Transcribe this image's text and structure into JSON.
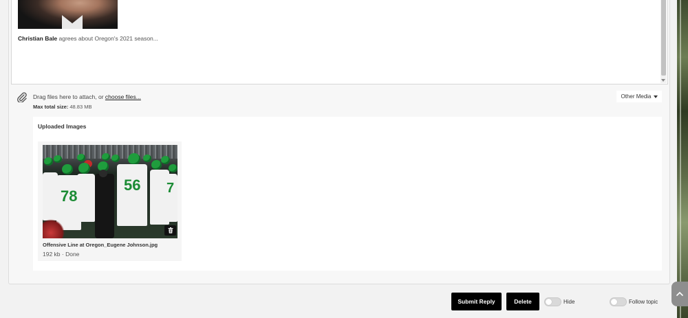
{
  "editor": {
    "quote_author": "Christian Bale",
    "quote_text": " agrees about Oregon's 2021 season..."
  },
  "attach": {
    "drag_text": "Drag files here to attach, or ",
    "choose_link": "choose files...",
    "max_label": "Max total size:",
    "max_value": " 48.83 MB",
    "other_media": "Other Media"
  },
  "uploaded": {
    "title": "Uploaded Images",
    "files": [
      {
        "name": "Offensive Line at Oregon_Eugene Johnson.jpg",
        "meta": "192 kb · Done",
        "jersey_numbers": [
          "78",
          "56",
          "7"
        ]
      }
    ]
  },
  "actions": {
    "submit": "Submit Reply",
    "delete": "Delete",
    "hide": "Hide",
    "follow": "Follow topic"
  },
  "colors": {
    "oregon_green": "#1f9d3d",
    "button_bg": "#000000",
    "panel_bg": "#ffffff"
  }
}
